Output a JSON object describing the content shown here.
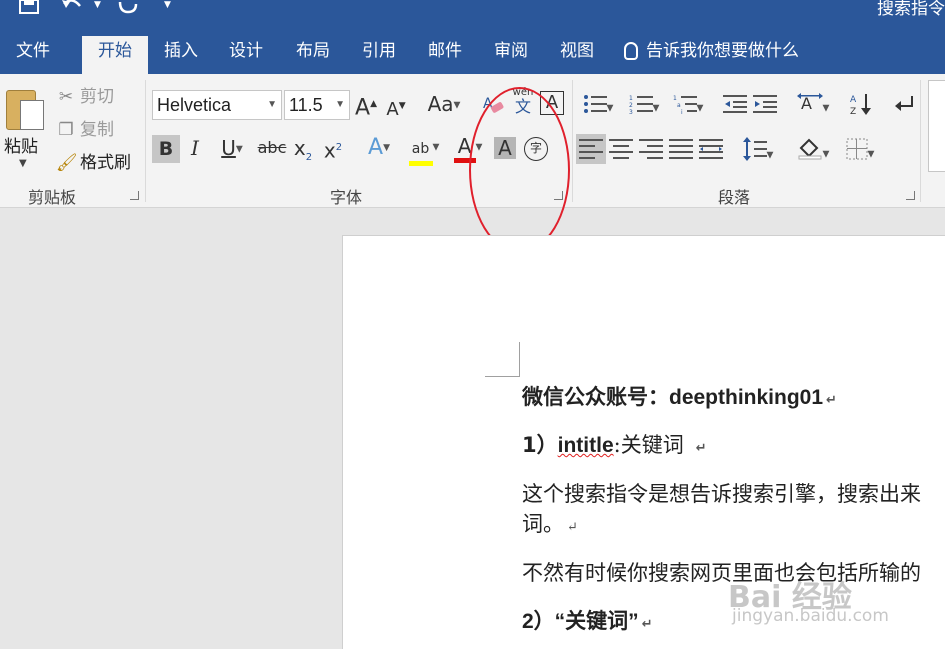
{
  "titlebar": {
    "doc_title": "搜索指令",
    "bg": "#2b579a"
  },
  "tabs": [
    {
      "label": "文件"
    },
    {
      "label": "开始",
      "active": true
    },
    {
      "label": "插入"
    },
    {
      "label": "设计"
    },
    {
      "label": "布局"
    },
    {
      "label": "引用"
    },
    {
      "label": "邮件"
    },
    {
      "label": "审阅"
    },
    {
      "label": "视图"
    }
  ],
  "tellme": "告诉我你想要做什么",
  "clipboard": {
    "paste": "粘贴",
    "cut": "剪切",
    "copy": "复制",
    "format_painter": "格式刷",
    "group_label": "剪贴板"
  },
  "font": {
    "name": "Helvetica",
    "size": "11.5",
    "group_label": "字体",
    "phonetic_label": "wén",
    "phonetic_char": "文",
    "grow": "A",
    "shrink": "A",
    "change_case": "Aa",
    "bold": "B",
    "italic": "I",
    "underline": "U",
    "strike": "abc",
    "subscript": "x",
    "sub_mark": "2",
    "superscript": "x",
    "sup_mark": "2",
    "text_effect": "A",
    "highlight": "ab",
    "font_color": "A",
    "char_shading": "A",
    "char_border": "A",
    "enclose": "字"
  },
  "paragraph": {
    "group_label": "段落"
  },
  "document": {
    "line1_a": "微信公众账号：",
    "line1_b": "deepthinking01",
    "line2_a": "1）",
    "line2_b": "intitle",
    "line2_c": ":关键词",
    "line3": "这个搜索指令是想告诉搜索引擎，搜索出来",
    "line4": "词。",
    "line5": "不然有时候你搜索网页里面也会包括所输的",
    "line6": "2）“关键词”",
    "para_mark": "↵"
  },
  "watermark": {
    "main": "Bai 经验",
    "sub": "jingyan.baidu.com"
  },
  "colors": {
    "accent": "#2b579a",
    "highlight_bar": "#ffff00",
    "font_color_bar": "#e01010",
    "annotation": "#e0202c"
  }
}
